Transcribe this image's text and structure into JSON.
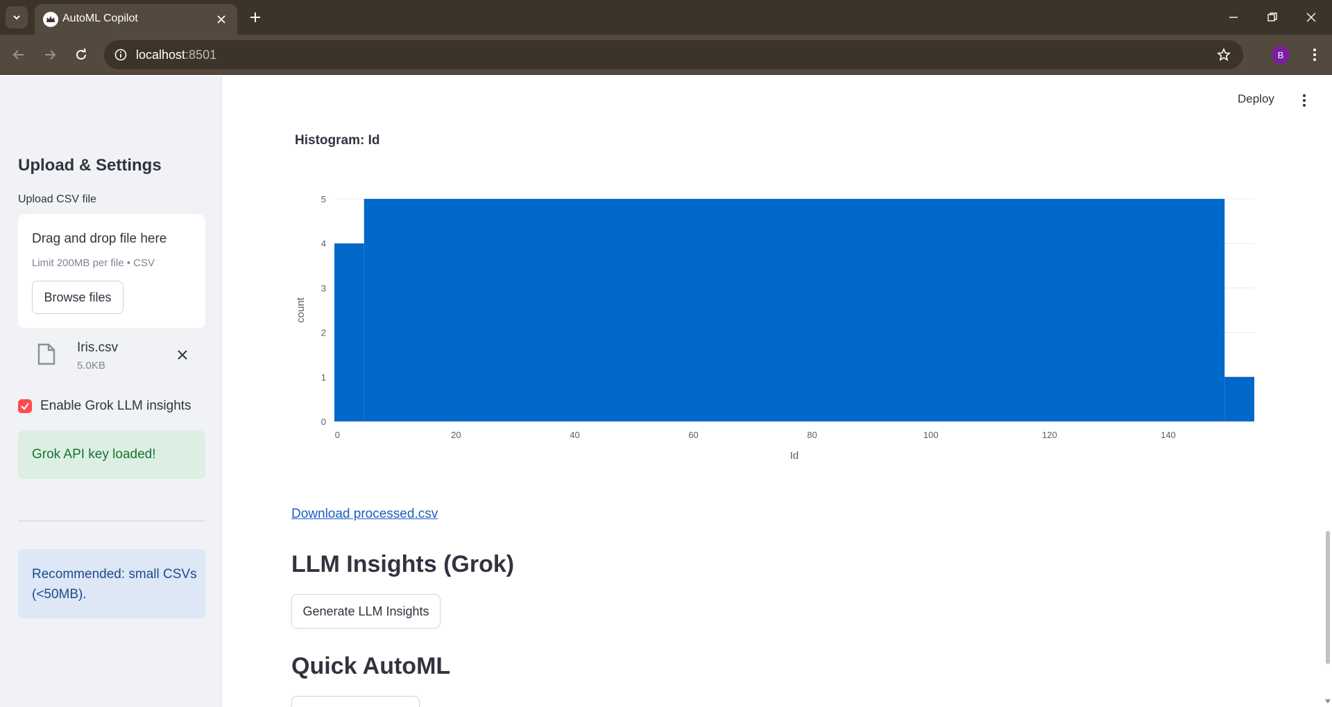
{
  "browser": {
    "tab_title": "AutoML Copilot",
    "url_host": "localhost",
    "url_port": ":8501",
    "profile_initial": "B"
  },
  "sidebar": {
    "title": "Upload & Settings",
    "upload_label": "Upload CSV file",
    "dropzone_title": "Drag and drop file here",
    "dropzone_limit": "Limit 200MB per file • CSV",
    "browse_label": "Browse files",
    "file_name": "Iris.csv",
    "file_size": "5.0KB",
    "checkbox_label": "Enable Grok LLM insights",
    "checkbox_checked": true,
    "success_message": "Grok API key loaded!",
    "info_message": "Recommended: small CSVs (<50MB)."
  },
  "main": {
    "deploy_label": "Deploy",
    "histogram_title": "Histogram: Id",
    "download_link": "Download processed.csv",
    "llm_heading": "LLM Insights (Grok)",
    "generate_label": "Generate LLM Insights",
    "automl_heading": "Quick AutoML"
  },
  "colors": {
    "accent": "#ff4b4b",
    "bar": "#0068c9",
    "success_bg": "#dcefe2",
    "info_bg": "#dde7f5"
  },
  "chart_data": {
    "type": "bar",
    "xlabel": "Id",
    "ylabel": "count",
    "x_ticks": [
      0,
      20,
      40,
      60,
      80,
      100,
      120,
      140
    ],
    "y_ticks": [
      0,
      1,
      2,
      3,
      4,
      5
    ],
    "xlim": [
      -0.5,
      154.5
    ],
    "ylim": [
      0,
      5
    ],
    "bins": [
      {
        "x0": -0.5,
        "x1": 4.5,
        "count": 4
      },
      {
        "x0": 4.5,
        "x1": 149.5,
        "count": 5
      },
      {
        "x0": 149.5,
        "x1": 154.5,
        "count": 1
      }
    ],
    "grid": true
  }
}
